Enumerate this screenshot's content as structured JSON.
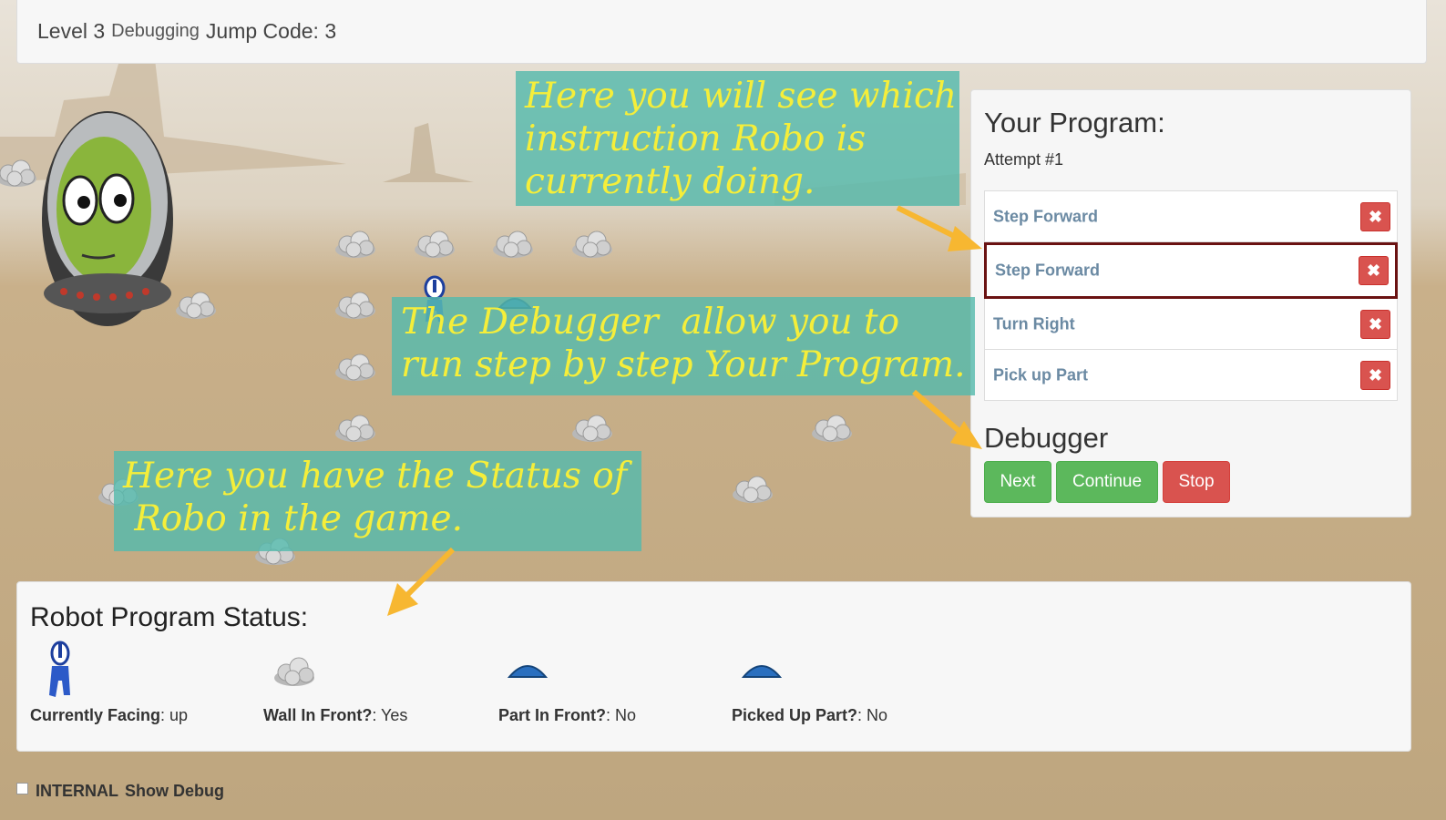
{
  "header": {
    "level": "Level 3",
    "mode": "Debugging",
    "jump_code": "Jump Code: 3"
  },
  "program": {
    "title": "Your Program:",
    "attempt": "Attempt #1",
    "instructions": [
      {
        "label": "Step Forward",
        "active": false
      },
      {
        "label": "Step Forward",
        "active": true
      },
      {
        "label": "Turn Right",
        "active": false
      },
      {
        "label": "Pick up Part",
        "active": false
      }
    ],
    "delete_glyph": "✖",
    "debugger_title": "Debugger",
    "buttons": {
      "next": "Next",
      "continue": "Continue",
      "stop": "Stop"
    }
  },
  "status": {
    "title": "Robot Program Status:",
    "items": [
      {
        "label": "Currently Facing",
        "value": ": up",
        "icon": "robot-icon"
      },
      {
        "label": "Wall In Front?",
        "value": ": Yes",
        "icon": "rock-icon"
      },
      {
        "label": "Part In Front?",
        "value": ": No",
        "icon": "part-icon"
      },
      {
        "label": "Picked Up Part?",
        "value": ": No",
        "icon": "part-icon"
      }
    ]
  },
  "debug_toggle": {
    "label_internal": "INTERNAL",
    "label_show": "Show Debug",
    "checked": false
  },
  "callouts": {
    "instruction": [
      "Here you will see which",
      "instruction Robo is",
      "currently doing."
    ],
    "debugger": [
      "The Debugger  allow you to",
      "run step by step Your Program."
    ],
    "status": [
      "Here you have the Status of",
      " Robo in the game."
    ]
  },
  "colors": {
    "accent_green": "#5cb85c",
    "danger_red": "#d9534f",
    "active_border": "#6a1212",
    "callout_bg": "#56baac",
    "callout_text": "#f5ee3a",
    "arrow": "#f7b731"
  }
}
